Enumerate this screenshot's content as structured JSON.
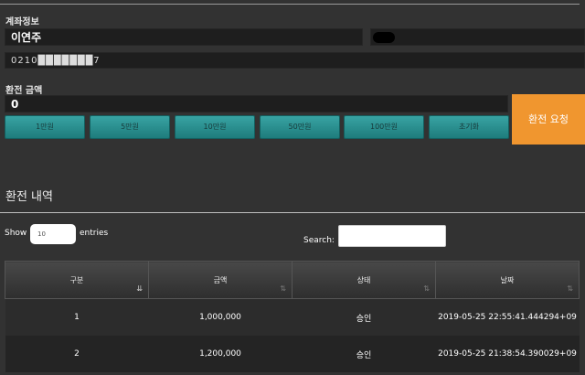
{
  "account": {
    "title": "계좌정보",
    "holder_name": "이연주",
    "account_number_masked": "0210███████7"
  },
  "exchange": {
    "amount_label": "환전 금액",
    "amount_value": "0",
    "quick_buttons": [
      "1만원",
      "5만원",
      "10만원",
      "50만원",
      "100만원",
      "초기화"
    ],
    "submit_label": "환전 요청"
  },
  "history": {
    "title": "환전 내역",
    "show_label": "Show",
    "entries_value": "10",
    "entries_label": "entries",
    "search_label": "Search:",
    "columns": [
      "구분",
      "금액",
      "상태",
      "날짜"
    ],
    "rows": [
      {
        "no": "1",
        "amount": "1,000,000",
        "status": "승인",
        "date": "2019-05-25 22:55:41.444294+09"
      },
      {
        "no": "2",
        "amount": "1,200,000",
        "status": "승인",
        "date": "2019-05-25 21:38:54.390029+09"
      }
    ]
  },
  "colors": {
    "accent_orange": "#f0962f",
    "button_teal": "#2a8f8f",
    "background": "#323232"
  },
  "icons": {
    "sort_desc": "sort-desc-icon",
    "sort_both": "sort-both-icon"
  }
}
